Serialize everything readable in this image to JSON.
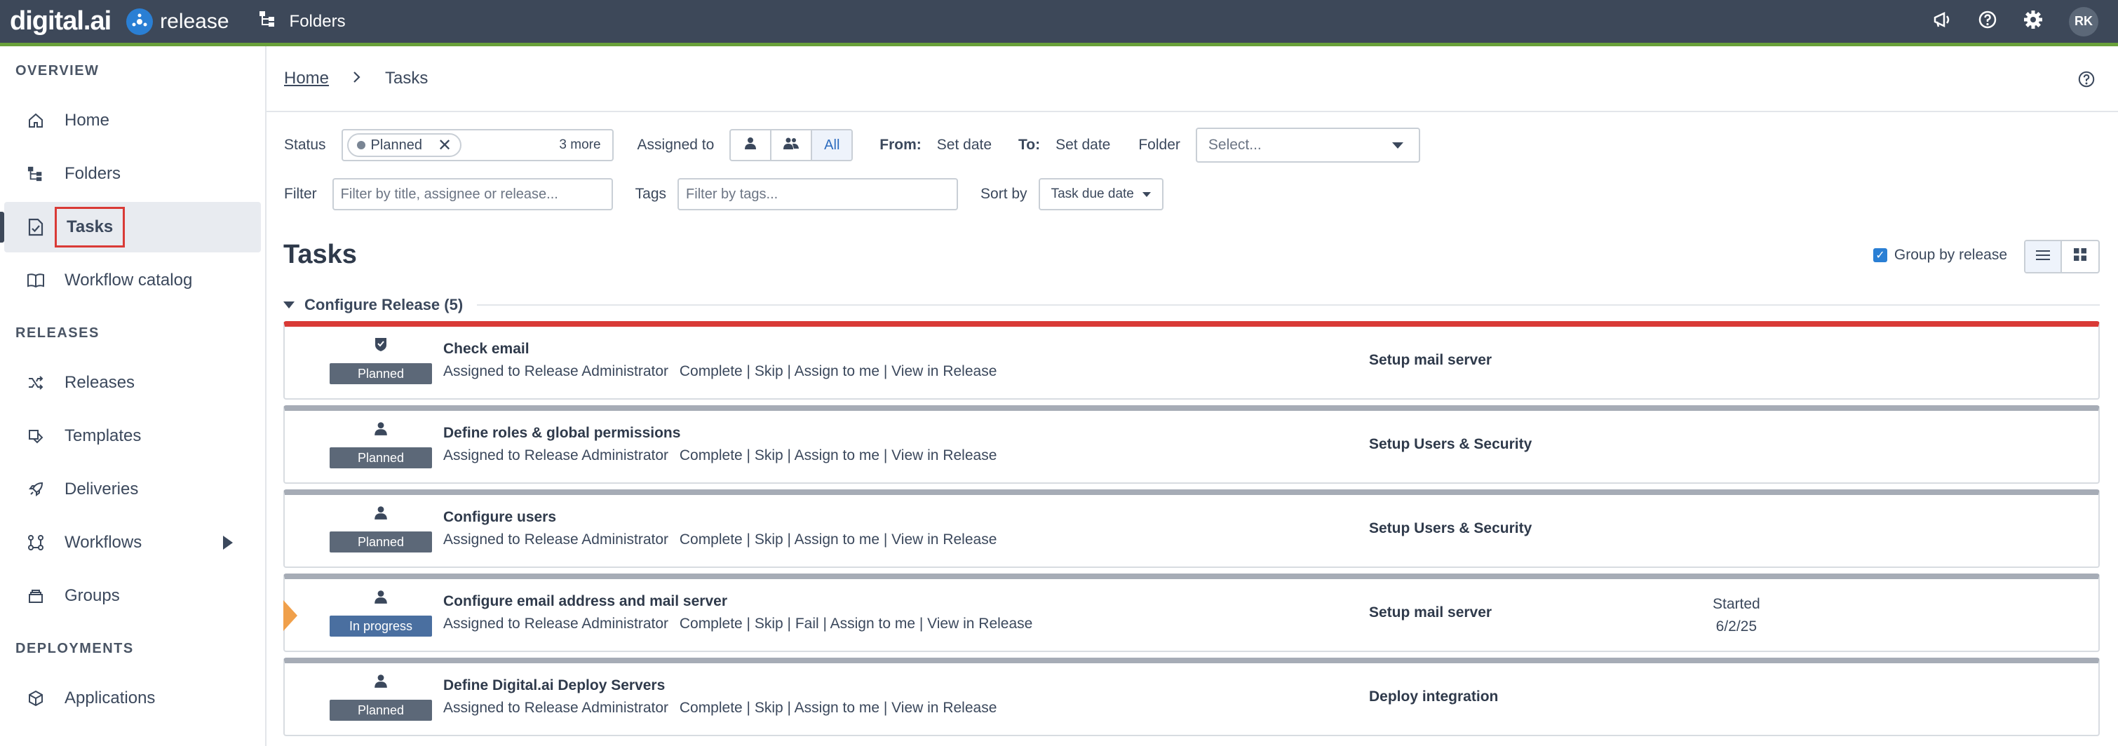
{
  "topbar": {
    "brand": "digital.ai",
    "product": "release",
    "folders_label": "Folders",
    "avatar_initials": "RK"
  },
  "sidebar": {
    "sections": [
      {
        "title": "OVERVIEW",
        "items": [
          {
            "label": "Home",
            "icon": "home-icon"
          },
          {
            "label": "Folders",
            "icon": "folders-icon"
          },
          {
            "label": "Tasks",
            "icon": "tasks-icon",
            "active": true
          },
          {
            "label": "Workflow catalog",
            "icon": "book-icon"
          }
        ]
      },
      {
        "title": "RELEASES",
        "items": [
          {
            "label": "Releases",
            "icon": "shuffle-icon"
          },
          {
            "label": "Templates",
            "icon": "template-icon"
          },
          {
            "label": "Deliveries",
            "icon": "rocket-icon"
          },
          {
            "label": "Workflows",
            "icon": "workflow-icon"
          },
          {
            "label": "Groups",
            "icon": "groups-icon"
          }
        ]
      },
      {
        "title": "DEPLOYMENTS",
        "items": [
          {
            "label": "Applications",
            "icon": "cube-icon"
          }
        ]
      }
    ]
  },
  "breadcrumb": {
    "home": "Home",
    "current": "Tasks"
  },
  "filters": {
    "status_label": "Status",
    "status_chip": "Planned",
    "status_more": "3 more",
    "assigned_label": "Assigned to",
    "assigned_all": "All",
    "from_label": "From:",
    "from_value": "Set date",
    "to_label": "To:",
    "to_value": "Set date",
    "folder_label": "Folder",
    "folder_placeholder": "Select...",
    "filter_label": "Filter",
    "filter_placeholder": "Filter by title, assignee or release...",
    "tags_label": "Tags",
    "tags_placeholder": "Filter by tags...",
    "sort_label": "Sort by",
    "sort_value": "Task due date"
  },
  "page": {
    "title": "Tasks",
    "group_by_label": "Group by release"
  },
  "group": {
    "header": "Configure Release (5)"
  },
  "tasks": [
    {
      "title": "Check email",
      "assigned": "Assigned to Release Administrator",
      "actions": "Complete | Skip | Assign to me | View in Release",
      "status": "Planned",
      "release": "Setup mail server",
      "icon": "shield-check-icon"
    },
    {
      "title": "Define roles & global permissions",
      "assigned": "Assigned to Release Administrator",
      "actions": "Complete | Skip | Assign to me | View in Release",
      "status": "Planned",
      "release": "Setup Users & Security",
      "icon": "user-icon"
    },
    {
      "title": "Configure users",
      "assigned": "Assigned to Release Administrator",
      "actions": "Complete | Skip | Assign to me | View in Release",
      "status": "Planned",
      "release": "Setup Users & Security",
      "icon": "user-icon"
    },
    {
      "title": "Configure email address and mail server",
      "assigned": "Assigned to Release Administrator",
      "actions": "Complete | Skip | Fail | Assign to me | View in Release",
      "status": "In progress",
      "release": "Setup mail server",
      "started_label": "Started",
      "started_date": "6/2/25",
      "icon": "user-icon"
    },
    {
      "title": "Define Digital.ai Deploy Servers",
      "assigned": "Assigned to Release Administrator",
      "actions": "Complete | Skip | Assign to me | View in Release",
      "status": "Planned",
      "release": "Deploy integration",
      "icon": "user-icon"
    }
  ]
}
